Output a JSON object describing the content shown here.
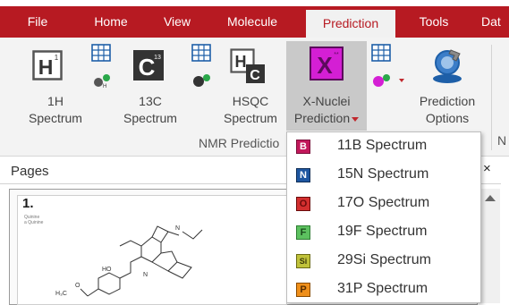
{
  "menubar": {
    "tabs": [
      {
        "label": "File"
      },
      {
        "label": "Home"
      },
      {
        "label": "View"
      },
      {
        "label": "Molecule"
      },
      {
        "label": "Prediction",
        "active": true
      },
      {
        "label": "Tools"
      },
      {
        "label": "Dat"
      }
    ]
  },
  "ribbon": {
    "buttons": {
      "h1": {
        "line1": "1H",
        "line2": "Spectrum",
        "icon": "H1-icon"
      },
      "c13": {
        "line1": "13C",
        "line2": "Spectrum",
        "icon": "C13-icon"
      },
      "hsqc": {
        "line1": "HSQC",
        "line2": "Spectrum",
        "icon": "HSQC-icon"
      },
      "xnuclei": {
        "line1": "X-Nuclei",
        "line2": "Prediction",
        "icon": "X-icon"
      },
      "options": {
        "line1": "Prediction",
        "line2": "Options",
        "icon": "wrench-gear-icon"
      }
    },
    "group_label": "NMR Predictio",
    "cut_label": "N"
  },
  "pages_panel": {
    "title": "Pages",
    "close": "×",
    "page_number": "1.",
    "thumb_text_1": "Quinine",
    "thumb_text_2": "a Quinine",
    "thumb_atoms": [
      "HO",
      "N",
      "H₃C",
      "O",
      "N"
    ]
  },
  "dropdown": {
    "items": [
      {
        "badge": "B",
        "label": "11B Spectrum",
        "color": "#c2185b"
      },
      {
        "badge": "N",
        "label": "15N Spectrum",
        "color": "#1e56a0"
      },
      {
        "badge": "O",
        "label": "17O Spectrum",
        "color": "#d32f2f"
      },
      {
        "badge": "F",
        "label": "19F Spectrum",
        "color": "#43a047"
      },
      {
        "badge": "Si",
        "label": "29Si Spectrum",
        "color": "#9e9d24"
      },
      {
        "badge": "P",
        "label": "31P Spectrum",
        "color": "#ef8f1a"
      }
    ]
  },
  "colors": {
    "menubar_bg": "#b71a22",
    "ribbon_bg": "#f3f3f3",
    "pressed_bg": "#c9c9c9",
    "xnuclei_magenta": "#d41fd4"
  }
}
